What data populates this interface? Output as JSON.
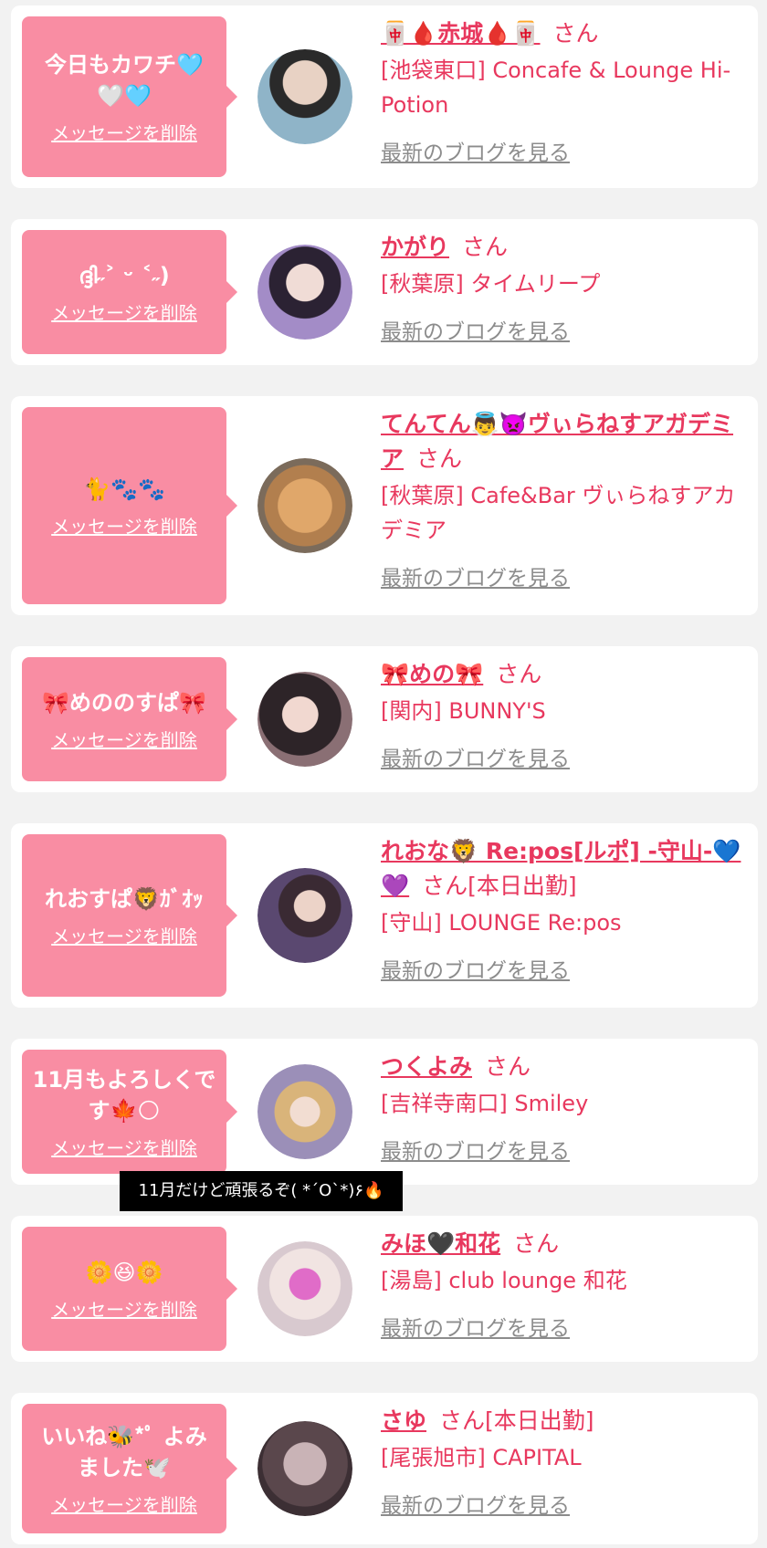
{
  "common": {
    "delete_label": "メッセージを削除",
    "blog_label": "最新のブログを見る",
    "san": "さん"
  },
  "tooltip": "11月だけど頑張るぞ( *´O`*)۶🔥",
  "items": [
    {
      "message": "今日もカワチ🩵\n🤍🩵",
      "name": "🀄🩸赤城🩸🀄",
      "extra": "",
      "shop": "[池袋東口] Concafe & Lounge Hi-Potion",
      "avatar_color": "#7f97a8"
    },
    {
      "message": "ദ്ദി˶˃ ᵕ ˂˶)",
      "name": "かがり",
      "extra": "",
      "shop": "[秋葉原] タイムリープ",
      "avatar_color": "#5a4a6e"
    },
    {
      "message": "🐈🐾🐾",
      "name": "てんてん👼👿ヴぃらねすアガデミア",
      "extra": "",
      "shop": "[秋葉原] Cafe&Bar ヴぃらねすアカデミア",
      "avatar_color": "#c9935a"
    },
    {
      "message": "🎀めののすぱ🎀",
      "name": "🎀めの🎀",
      "extra": "",
      "shop": "[関内] BUNNY'S",
      "avatar_color": "#5c4e55"
    },
    {
      "message": "れおすぱ🦁ｶﾞｵｯ",
      "name": "れおな🦁 Re:pos[ルポ] -守山-💙💜",
      "extra": "[本日出勤]",
      "shop": "[守山] LOUNGE Re:pos",
      "avatar_color": "#4a3a45"
    },
    {
      "message": "11月もよろしくです🍁🌕",
      "name": "つくよみ",
      "extra": "",
      "shop": "[吉祥寺南口] Smiley",
      "avatar_color": "#d8b470"
    },
    {
      "message": "🌼😆🌼",
      "name": "みほ🖤和花",
      "extra": "",
      "shop": "[湯島] club lounge 和花",
      "avatar_color": "#e9dfe3"
    },
    {
      "message": "いいね🐝*ﾟ よみました🕊️",
      "name": "さゆ",
      "extra": "[本日出勤]",
      "shop": "[尾張旭市] CAPITAL",
      "avatar_color": "#6b5b60"
    }
  ]
}
